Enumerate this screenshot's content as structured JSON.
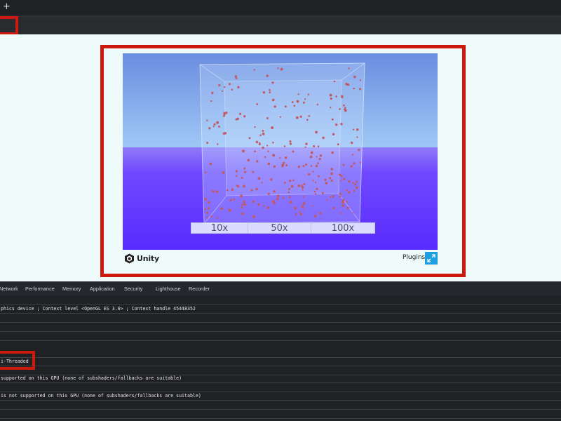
{
  "browser": {
    "new_tab_label": "+"
  },
  "unity": {
    "buttons": [
      "10x",
      "50x",
      "100x"
    ],
    "footer": {
      "logo_text": "Unity",
      "plugins_label": "Plugins"
    }
  },
  "devtools": {
    "tabs": [
      "Network",
      "Performance",
      "Memory",
      "Application",
      "Security",
      "Lighthouse",
      "Recorder"
    ]
  },
  "console": {
    "lines": [
      "",
      "phics device ; Context level  <OpenGL ES 3.0> ; Context handle 45448352",
      "",
      "",
      "",
      "",
      "i-Threaded",
      "",
      " supported on this GPU (none of subshaders/fallbacks are suitable)",
      "",
      "is not supported on this GPU (none of subshaders/fallbacks are suitable)",
      "",
      ""
    ]
  },
  "colors": {
    "highlight": "#cc1a0f",
    "sky_top": "#6b8ddf",
    "floor": "#6a35ff",
    "particle": "#c05a66",
    "fullscreen_button": "#1e9fe0"
  },
  "icons": [
    "plus-icon",
    "unity-cube-icon",
    "fullscreen-icon"
  ]
}
